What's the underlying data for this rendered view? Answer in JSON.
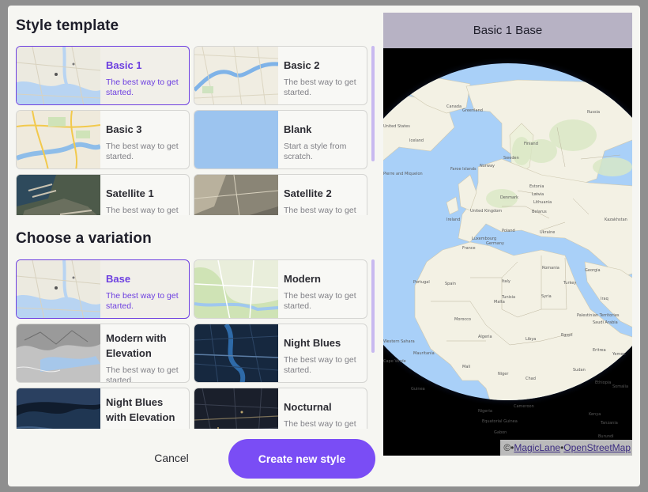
{
  "style_section": {
    "title": "Style template",
    "items": [
      {
        "title": "Basic 1",
        "desc": "The best way to get started.",
        "selected": true,
        "thumb": "basic-map"
      },
      {
        "title": "Basic 2",
        "desc": "The best way to get started.",
        "selected": false,
        "thumb": "river-map"
      },
      {
        "title": "Basic 3",
        "desc": "The best way to get started.",
        "selected": false,
        "thumb": "roads-map"
      },
      {
        "title": "Blank",
        "desc": "Start a style from scratch.",
        "selected": false,
        "thumb": "blank"
      },
      {
        "title": "Satellite 1",
        "desc": "The best way to get started.",
        "selected": false,
        "thumb": "satellite-port"
      },
      {
        "title": "Satellite 2",
        "desc": "The best way to get started.",
        "selected": false,
        "thumb": "satellite-city"
      }
    ]
  },
  "variation_section": {
    "title": "Choose a variation",
    "items": [
      {
        "title": "Base",
        "desc": "The best way to get started.",
        "selected": true,
        "thumb": "basic-map"
      },
      {
        "title": "Modern",
        "desc": "The best way to get started.",
        "selected": false,
        "thumb": "green-map"
      },
      {
        "title": "Modern with Elevation",
        "desc": "The best way to get started.",
        "selected": false,
        "thumb": "terrain"
      },
      {
        "title": "Night Blues",
        "desc": "The best way to get started.",
        "selected": false,
        "thumb": "night-blue"
      },
      {
        "title": "Night Blues with Elevation",
        "desc": "The best way to get started.",
        "selected": false,
        "thumb": "night-terrain"
      },
      {
        "title": "Nocturnal",
        "desc": "The best way to get started.",
        "selected": false,
        "thumb": "nocturnal"
      }
    ]
  },
  "buttons": {
    "cancel": "Cancel",
    "create": "Create new style"
  },
  "preview": {
    "title": "Basic 1 Base",
    "attribution_prefix": "©",
    "attribution_links": [
      "MagicLane",
      "OpenStreetMap"
    ],
    "map_labels": [
      "Greenland",
      "Russia",
      "Iceland",
      "Norway",
      "Finland",
      "Sweden",
      "Estonia",
      "Faroe Islands",
      "Latvia",
      "Lithuania",
      "Belarus",
      "Ukraine",
      "Kazakhstan",
      "Denmark",
      "United Kingdom",
      "Ireland",
      "Poland",
      "Germany",
      "France",
      "Luxembourg",
      "Spain",
      "Portugal",
      "Italy",
      "Romania",
      "Georgia",
      "Turkey",
      "Tunisia",
      "Malta",
      "Syria",
      "Iraq",
      "Morocco",
      "Algeria",
      "Libya",
      "Egypt",
      "Saudi Arabia",
      "Western Sahara",
      "Mauritania",
      "Mali",
      "Niger",
      "Chad",
      "Sudan",
      "Eritrea",
      "Ethiopia",
      "Cape Verde",
      "Guinea",
      "Nigeria",
      "Cameroon",
      "Equatorial Guinea",
      "Gabon",
      "Kenya",
      "Somalia",
      "Burundi",
      "Tanzania",
      "Yemen",
      "Palestinian Territories",
      "Canada",
      "United States",
      "Pierre and Miquelon"
    ]
  },
  "colors": {
    "accent": "#7a4df5",
    "selected_border": "#6d3fe0",
    "land": "#f3f1e4",
    "water": "#a9d0f8",
    "header": "#b7b2c4"
  }
}
